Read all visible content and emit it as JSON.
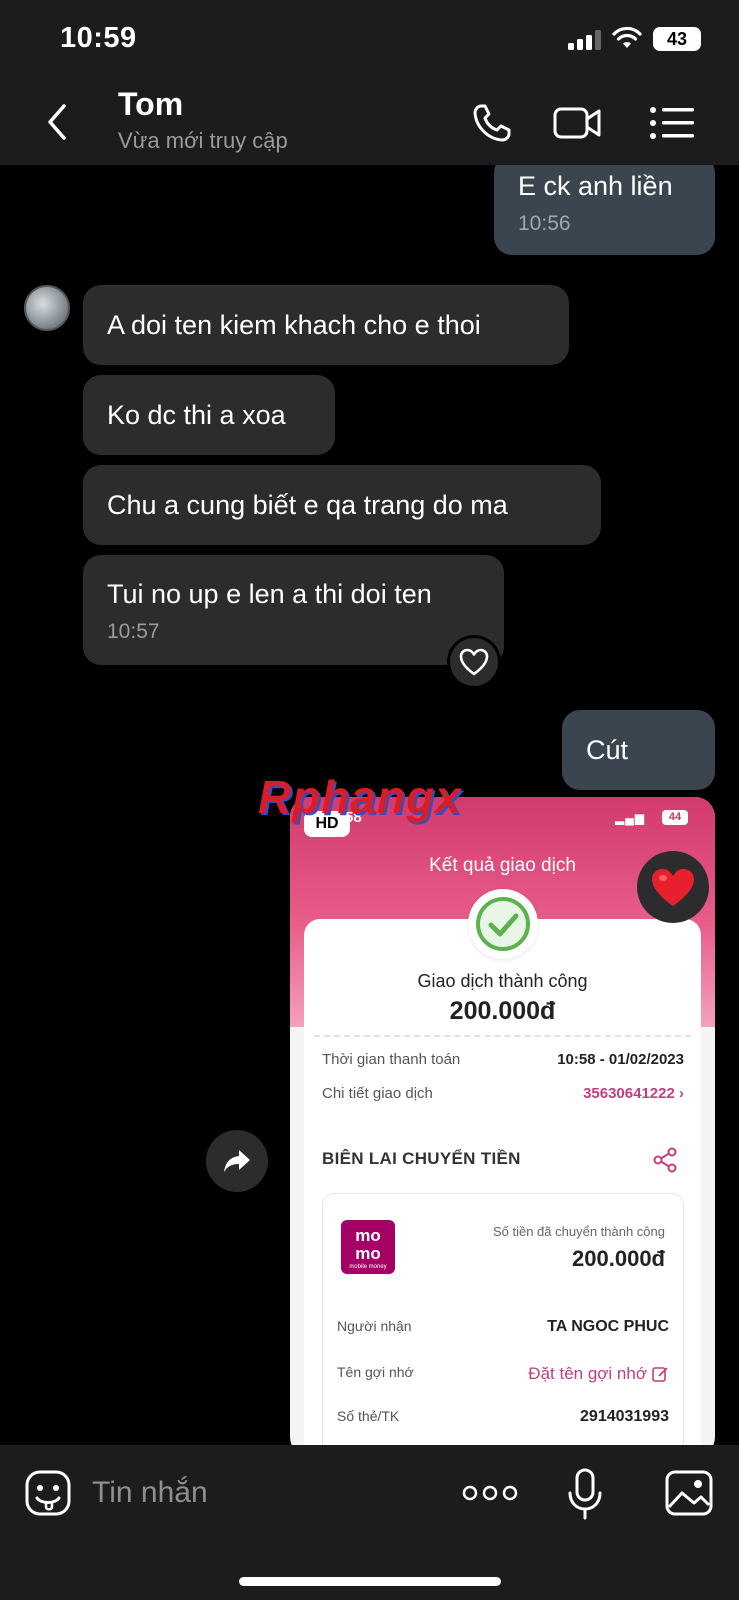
{
  "status_bar": {
    "time": "10:59",
    "battery": "43"
  },
  "header": {
    "contact_name": "Tom",
    "contact_status": "Vừa mới truy cập"
  },
  "messages": [
    {
      "direction": "out",
      "text": "E ck anh liền",
      "time": "10:56"
    },
    {
      "direction": "in",
      "text": "A doi ten kiem khach cho e thoi"
    },
    {
      "direction": "in",
      "text": "Ko dc thi a xoa"
    },
    {
      "direction": "in",
      "text": "Chu a cung biết e qa trang do ma"
    },
    {
      "direction": "in",
      "text": "Tui no up e len a thi doi ten",
      "time": "10:57"
    },
    {
      "direction": "out",
      "text": "Cút"
    }
  ],
  "watermark": "Rphangx",
  "image_message": {
    "hd_badge": "HD",
    "time": ":58",
    "battery": "44",
    "title": "Kết quả giao dịch",
    "success_text": "Giao dịch thành công",
    "amount": "200.000đ",
    "rows": [
      {
        "label": "Thời gian thanh toán",
        "value": "10:58 - 01/02/2023"
      },
      {
        "label": "Chi tiết giao dịch",
        "value": "35630641222 ›"
      }
    ],
    "section_title": "BIÊN LAI CHUYỂN TIỀN",
    "receipt": {
      "logo_line1": "mo",
      "logo_line2": "mo",
      "logo_sub": "mobile money",
      "amount_label": "Số tiền đã chuyển thành công",
      "amount": "200.000đ",
      "rows": [
        {
          "label": "Người nhận",
          "value": "TA NGOC PHUC"
        },
        {
          "label": "Tên gợi nhớ",
          "value": "Đặt tên gợi nhớ"
        },
        {
          "label": "Số thẻ/TK",
          "value": "2914031993"
        }
      ]
    }
  },
  "input_bar": {
    "placeholder": "Tin nhắn"
  },
  "colors": {
    "incoming_bubble": "#2c2c2e",
    "outgoing_bubble": "#3a4550",
    "momo_pink": "#a50064",
    "heart_red": "#e8202e"
  },
  "icons": {
    "back": "chevron-left-icon",
    "call": "phone-icon",
    "video": "video-camera-icon",
    "menu": "list-menu-icon",
    "reaction": "heart-icon",
    "share": "share-arrow-icon",
    "emoji": "sticker-icon",
    "more": "more-dots-icon",
    "mic": "microphone-icon",
    "gallery": "image-gallery-icon"
  }
}
